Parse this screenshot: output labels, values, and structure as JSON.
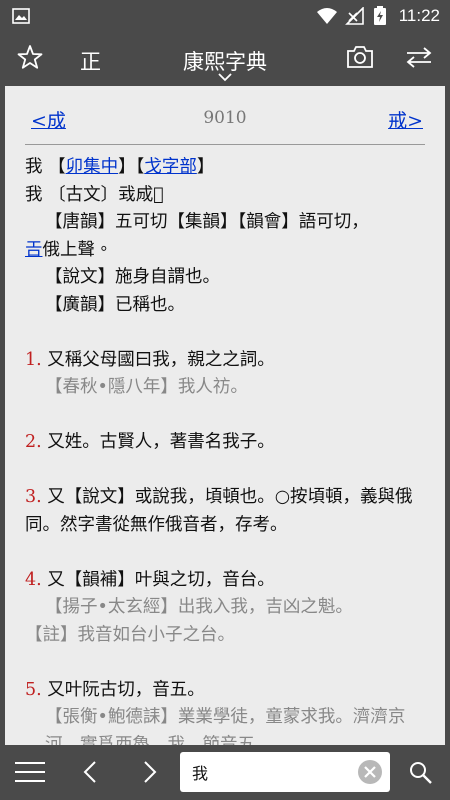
{
  "status": {
    "time": "11:22"
  },
  "appbar": {
    "title": "康熙字典",
    "mode_label": "正"
  },
  "nav": {
    "prev": "<成",
    "number": "9010",
    "next": "戒>"
  },
  "entry": {
    "char": "我",
    "bracket_open": "【",
    "bracket_mid": "】【",
    "bracket_close": "】",
    "volume": "卯集中",
    "radical": "戈字部",
    "ancient_prefix": "我",
    "ancient": "〔古文〕㦱𢦓𢧓",
    "pron_a": "【唐韻】五可切【集韻】【韻會】語可切，",
    "pron_link": "𢀛",
    "pron_b": "俄上聲。",
    "shuowen": "【說文】施身自謂也。",
    "guangyun": "【廣韻】已稱也。"
  },
  "defs": [
    {
      "num": "1.",
      "text": "又稱父母國曰我，親之之詞。",
      "cite": "【春秋•隱八年】我人祊。"
    },
    {
      "num": "2.",
      "text": "又姓。古賢人，著書名我子。"
    },
    {
      "num": "3.",
      "text": "又【說文】或說我，頃頓也。○按頃頓，義與俄同。然字書從無作俄音者，存考。"
    },
    {
      "num": "4.",
      "text": "又【韻補】叶與之切，音台。",
      "cite": "【揚子•太玄經】出我入我，吉凶之魁。",
      "note": "【註】我音如台小子之台。"
    },
    {
      "num": "5.",
      "text": "又叶阮古切，音五。",
      "cite": "【張衡•鮑德誄】業業學徒，童蒙求我。濟濟京河，實爲西魯。我，節音五。"
    }
  ],
  "search": {
    "value": "我"
  },
  "colors": {
    "bar": "#4a4a4a",
    "link": "#0033cc",
    "number": "#c02020",
    "paper": "#ececec"
  }
}
